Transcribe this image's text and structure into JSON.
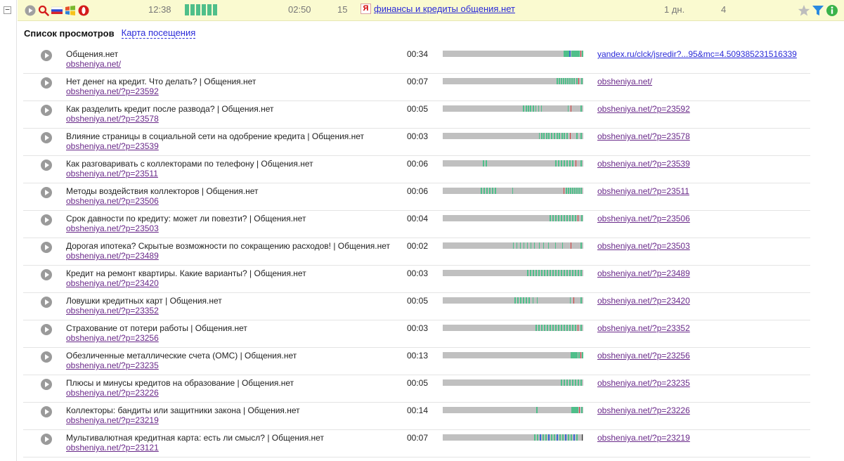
{
  "session": {
    "collapse_symbol": "−",
    "icons": [
      "play-icon",
      "search-icon",
      "russia-flag-icon",
      "windows-icon",
      "opera-icon"
    ],
    "time": "12:38",
    "duration": "02:50",
    "depth": "15",
    "referrer_icon": "Я",
    "referrer": "финансы и кредиты общения.нет",
    "days": "1 дн.",
    "visits": "4",
    "right_icons": [
      "star-icon",
      "filter-icon",
      "info-icon"
    ]
  },
  "tabs": {
    "views": "Список просмотров",
    "map": "Карта посещения"
  },
  "visits": [
    {
      "title": "Общения.нет",
      "url": "obsheniya.net/",
      "duration": "00:34",
      "referrer": "yandex.ru/clck/jsredir?...95&mc=4.509385231516339"
    },
    {
      "title": "Нет денег на кредит. Что делать? | Общения.нет",
      "url": "obsheniya.net/?p=23592",
      "duration": "00:07",
      "referrer": "obsheniya.net/"
    },
    {
      "title": "Как разделить кредит после развода? | Общения.нет",
      "url": "obsheniya.net/?p=23578",
      "duration": "00:05",
      "referrer": "obsheniya.net/?p=23592"
    },
    {
      "title": "Влияние страницы в социальной сети на одобрение кредита | Общения.нет",
      "url": "obsheniya.net/?p=23539",
      "duration": "00:03",
      "referrer": "obsheniya.net/?p=23578"
    },
    {
      "title": "Как разговаривать с коллекторами по телефону | Общения.нет",
      "url": "obsheniya.net/?p=23511",
      "duration": "00:06",
      "referrer": "obsheniya.net/?p=23539"
    },
    {
      "title": "Методы воздействия коллекторов | Общения.нет",
      "url": "obsheniya.net/?p=23506",
      "duration": "00:06",
      "referrer": "obsheniya.net/?p=23511"
    },
    {
      "title": "Срок давности по кредиту: может ли повезти? | Общения.нет",
      "url": "obsheniya.net/?p=23503",
      "duration": "00:04",
      "referrer": "obsheniya.net/?p=23506"
    },
    {
      "title": "Дорогая ипотека? Скрытые возможности по сокращению расходов! | Общения.нет",
      "url": "obsheniya.net/?p=23489",
      "duration": "00:02",
      "referrer": "obsheniya.net/?p=23503"
    },
    {
      "title": "Кредит на ремонт квартиры. Какие варианты? | Общения.нет",
      "url": "obsheniya.net/?p=23420",
      "duration": "00:03",
      "referrer": "obsheniya.net/?p=23489"
    },
    {
      "title": "Ловушки кредитных карт | Общения.нет",
      "url": "obsheniya.net/?p=23352",
      "duration": "00:05",
      "referrer": "obsheniya.net/?p=23420"
    },
    {
      "title": "Страхование от потери работы | Общения.нет",
      "url": "obsheniya.net/?p=23256",
      "duration": "00:03",
      "referrer": "obsheniya.net/?p=23352"
    },
    {
      "title": "Обезличенные металлические счета (ОМС) | Общения.нет",
      "url": "obsheniya.net/?p=23235",
      "duration": "00:13",
      "referrer": "obsheniya.net/?p=23256"
    },
    {
      "title": "Плюсы и минусы кредитов на образование | Общения.нет",
      "url": "obsheniya.net/?p=23226",
      "duration": "00:05",
      "referrer": "obsheniya.net/?p=23235"
    },
    {
      "title": "Коллекторы: бандиты или защитники закона | Общения.нет",
      "url": "obsheniya.net/?p=23219",
      "duration": "00:14",
      "referrer": "obsheniya.net/?p=23226"
    },
    {
      "title": "Мультивалютная кредитная карта: есть ли смысл? | Общения.нет",
      "url": "obsheniya.net/?p=23121",
      "duration": "00:07",
      "referrer": "obsheniya.net/?p=23219"
    }
  ],
  "colors": {
    "header_bg": "#fafad0",
    "activity_green": "#4fbf8a",
    "activity_red": "#d23a3a",
    "activity_blue": "#3a6ad2",
    "link_visited": "#6a2a8a",
    "link": "#2a2ad8"
  }
}
